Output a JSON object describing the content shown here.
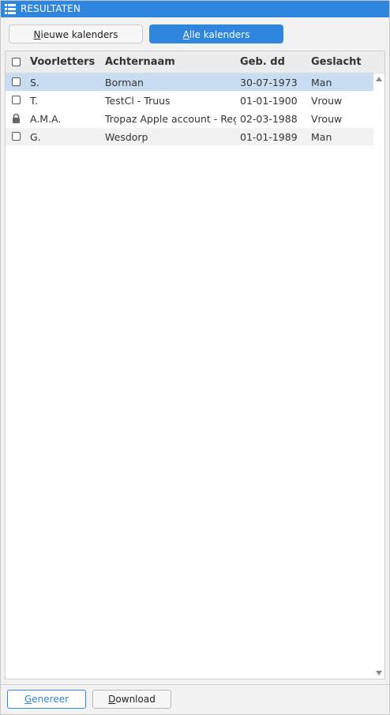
{
  "panel": {
    "title": "RESULTATEN"
  },
  "tabs": {
    "new_prefix": "N",
    "new_rest": "ieuwe kalenders",
    "all_prefix": "A",
    "all_rest": "lle kalenders"
  },
  "table": {
    "headers": [
      "Voorletters",
      "Achternaam",
      "Geb. dd",
      "Geslacht"
    ],
    "rows": [
      {
        "marker": "checkbox",
        "initials": "S.",
        "lastname": "Borman",
        "dob": "30-07-1973",
        "gender": "Man",
        "selected": true
      },
      {
        "marker": "checkbox",
        "initials": "T.",
        "lastname": "TestCl - Truus",
        "dob": "01-01-1900",
        "gender": "Vrouw",
        "selected": false
      },
      {
        "marker": "lock-icon",
        "initials": "A.M.A.",
        "lastname": "Tropaz Apple account - Regu",
        "dob": "02-03-1988",
        "gender": "Vrouw",
        "selected": false
      },
      {
        "marker": "checkbox",
        "initials": "G.",
        "lastname": "Wesdorp",
        "dob": "01-01-1989",
        "gender": "Man",
        "selected": false
      }
    ]
  },
  "footer": {
    "generate_prefix": "G",
    "generate_rest": "enereer",
    "download_prefix": "D",
    "download_rest": "ownload"
  },
  "colors": {
    "accent": "#2f86de",
    "selected_row": "#c8ddf2"
  }
}
